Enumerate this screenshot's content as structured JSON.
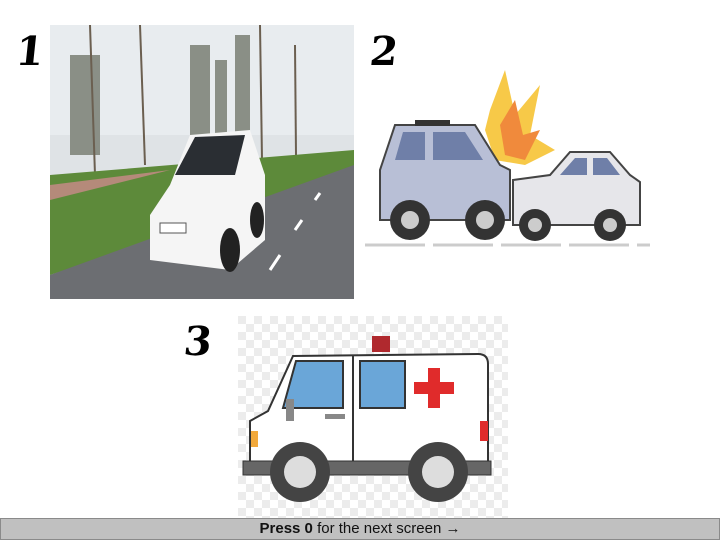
{
  "labels": {
    "one": "1",
    "two": "2",
    "three": "3"
  },
  "images": {
    "car": "white car driving on road",
    "crash": "two cars colliding",
    "ambulance": "ambulance"
  },
  "footer": {
    "press": "Press 0",
    "rest": "for the next screen",
    "arrow": "→"
  }
}
